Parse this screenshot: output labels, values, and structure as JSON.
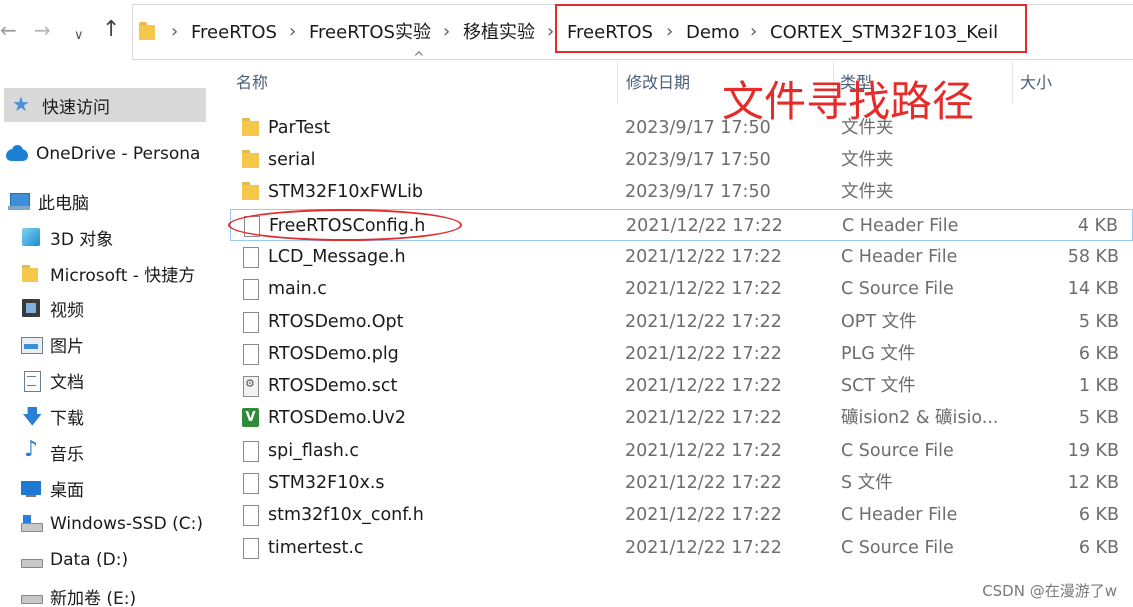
{
  "breadcrumb": [
    "FreeRTOS",
    "FreeRTOS实验",
    "移植实验",
    "FreeRTOS",
    "Demo",
    "CORTEX_STM32F103_Keil"
  ],
  "columns": {
    "name": "名称",
    "date": "修改日期",
    "type": "类型",
    "size": "大小"
  },
  "nav_pane": [
    {
      "label": "快速访问",
      "icon": "star-icon"
    },
    {
      "label": "OneDrive - Persona",
      "icon": "cloud-icon"
    },
    {
      "label": "此电脑",
      "icon": "computer-icon"
    },
    {
      "label": "3D 对象",
      "icon": "cube-icon"
    },
    {
      "label": "Microsoft - 快捷方",
      "icon": "folder-icon"
    },
    {
      "label": "视频",
      "icon": "video-icon"
    },
    {
      "label": "图片",
      "icon": "picture-icon"
    },
    {
      "label": "文档",
      "icon": "document-icon"
    },
    {
      "label": "下载",
      "icon": "download-icon"
    },
    {
      "label": "音乐",
      "icon": "music-icon"
    },
    {
      "label": "桌面",
      "icon": "desktop-icon"
    },
    {
      "label": "Windows-SSD (C:)",
      "icon": "drive-icon"
    },
    {
      "label": "Data (D:)",
      "icon": "drive-icon"
    },
    {
      "label": "新加卷 (E:)",
      "icon": "drive-icon"
    }
  ],
  "files": [
    {
      "name": "ParTest",
      "date": "2023/9/17 17:50",
      "type": "文件夹",
      "size": "",
      "icon": "folder-icon"
    },
    {
      "name": "serial",
      "date": "2023/9/17 17:50",
      "type": "文件夹",
      "size": "",
      "icon": "folder-icon"
    },
    {
      "name": "STM32F10xFWLib",
      "date": "2023/9/17 17:50",
      "type": "文件夹",
      "size": "",
      "icon": "folder-icon"
    },
    {
      "name": "FreeRTOSConfig.h",
      "date": "2021/12/22 17:22",
      "type": "C Header File",
      "size": "4 KB",
      "icon": "file-icon"
    },
    {
      "name": "LCD_Message.h",
      "date": "2021/12/22 17:22",
      "type": "C Header File",
      "size": "58 KB",
      "icon": "file-icon"
    },
    {
      "name": "main.c",
      "date": "2021/12/22 17:22",
      "type": "C Source File",
      "size": "14 KB",
      "icon": "file-icon"
    },
    {
      "name": "RTOSDemo.Opt",
      "date": "2021/12/22 17:22",
      "type": "OPT 文件",
      "size": "5 KB",
      "icon": "file-icon"
    },
    {
      "name": "RTOSDemo.plg",
      "date": "2021/12/22 17:22",
      "type": "PLG 文件",
      "size": "6 KB",
      "icon": "file-icon"
    },
    {
      "name": "RTOSDemo.sct",
      "date": "2021/12/22 17:22",
      "type": "SCT 文件",
      "size": "1 KB",
      "icon": "script-file-icon"
    },
    {
      "name": "RTOSDemo.Uv2",
      "date": "2021/12/22 17:22",
      "type": "礦ision2 & 礦isio...",
      "size": "5 KB",
      "icon": "keil-project-icon"
    },
    {
      "name": "spi_flash.c",
      "date": "2021/12/22 17:22",
      "type": "C Source File",
      "size": "19 KB",
      "icon": "file-icon"
    },
    {
      "name": "STM32F10x.s",
      "date": "2021/12/22 17:22",
      "type": "S 文件",
      "size": "12 KB",
      "icon": "file-icon"
    },
    {
      "name": "stm32f10x_conf.h",
      "date": "2021/12/22 17:22",
      "type": "C Header File",
      "size": "6 KB",
      "icon": "file-icon"
    },
    {
      "name": "timertest.c",
      "date": "2021/12/22 17:22",
      "type": "C Source File",
      "size": "6 KB",
      "icon": "file-icon"
    }
  ],
  "annotation": "文件寻找路径",
  "watermark": "CSDN @在漫游了w",
  "colors": {
    "annotation_red": "#e62b2b",
    "selection_border": "#99c9ef",
    "folder_yellow": "#f5c74a"
  }
}
